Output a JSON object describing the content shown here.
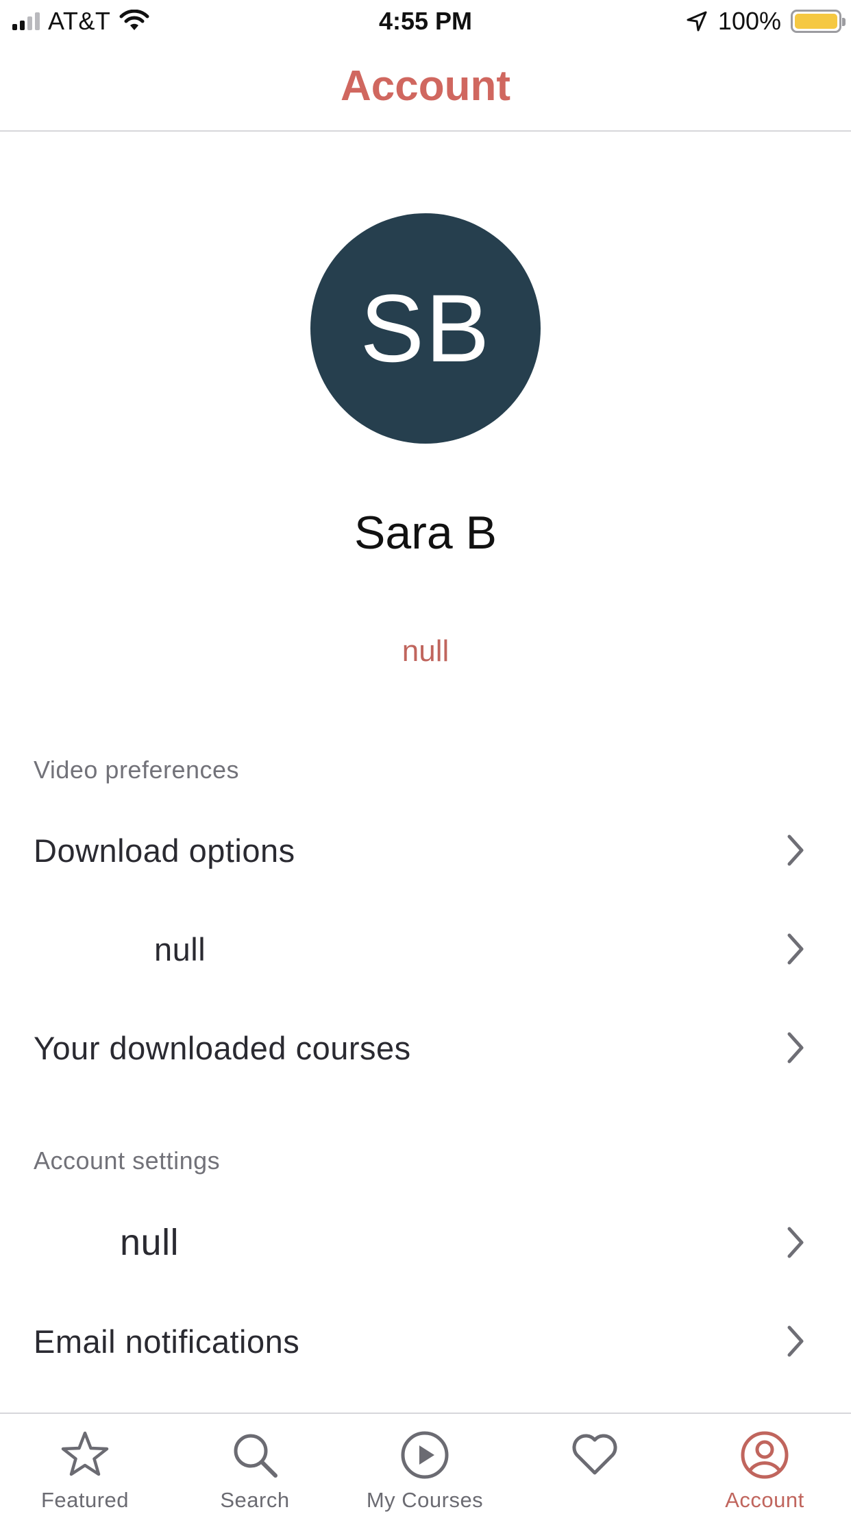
{
  "status_bar": {
    "carrier": "AT&T",
    "time": "4:55 PM",
    "battery": "100%"
  },
  "header": {
    "title": "Account"
  },
  "profile": {
    "initials": "SB",
    "name": "Sara B",
    "link": "null"
  },
  "sections": [
    {
      "header": "Video preferences",
      "items": [
        {
          "label": "Download options"
        },
        {
          "label": "null"
        },
        {
          "label": "Your downloaded courses"
        }
      ]
    },
    {
      "header": "Account settings",
      "items": [
        {
          "label": "null"
        },
        {
          "label": "Email notifications"
        }
      ]
    }
  ],
  "tab_bar": {
    "items": [
      {
        "label": "Featured",
        "icon": "star-icon"
      },
      {
        "label": "Search",
        "icon": "search-icon"
      },
      {
        "label": "My Courses",
        "icon": "play-circle-icon"
      },
      {
        "label": "",
        "icon": "heart-icon"
      },
      {
        "label": "Account",
        "icon": "account-icon",
        "active": true
      }
    ]
  },
  "colors": {
    "accent": "#d0675f",
    "avatar_bg": "#263f4e",
    "battery": "#f5c842"
  }
}
